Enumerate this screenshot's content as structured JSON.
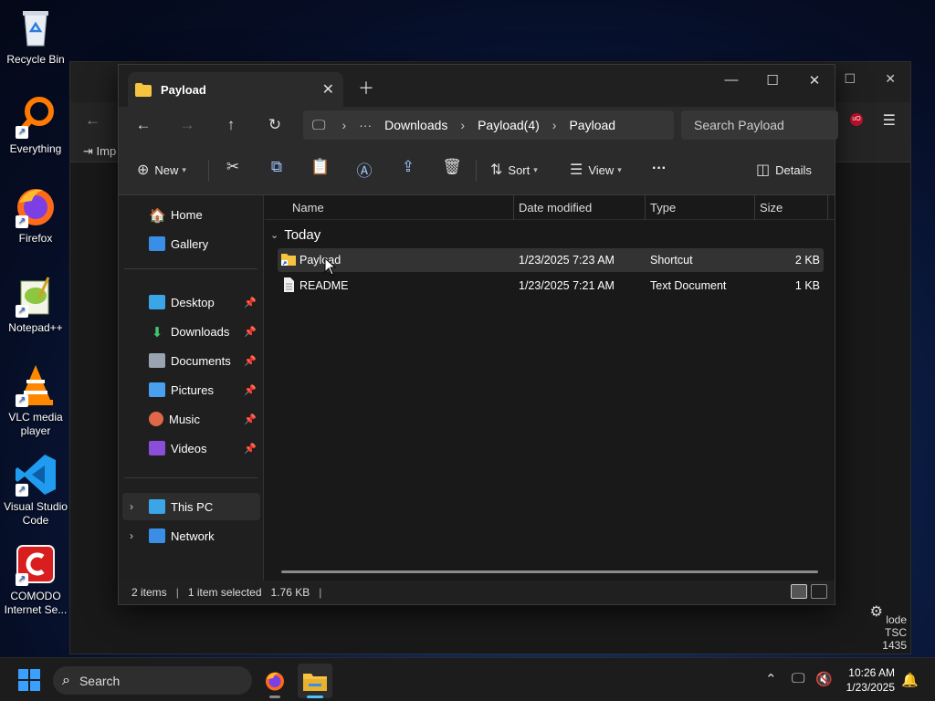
{
  "desktop": {
    "icons": [
      {
        "label": "Recycle Bin",
        "icon": "recycle-bin-icon"
      },
      {
        "label": "Everything",
        "icon": "everything-search-icon"
      },
      {
        "label": "Firefox",
        "icon": "firefox-icon"
      },
      {
        "label": "Notepad++",
        "icon": "notepad-plus-plus-icon"
      },
      {
        "label": "VLC media player",
        "icon": "vlc-icon"
      },
      {
        "label": "Visual Studio Code",
        "icon": "vscode-icon"
      },
      {
        "label": "COMODO Internet Se...",
        "icon": "comodo-icon"
      }
    ],
    "background_window": {
      "toolbar_label": "Imp",
      "side_text": [
        "lode",
        "TSC",
        "1435"
      ]
    }
  },
  "explorer": {
    "tab_title": "Payload",
    "caption": {
      "minimize": "—",
      "maximize": "☐",
      "close": "✕"
    },
    "breadcrumbs": [
      "Downloads",
      "Payload(4)",
      "Payload"
    ],
    "search_placeholder": "Search Payload",
    "commands": {
      "new": "New",
      "sort": "Sort",
      "view": "View",
      "more": "···",
      "details": "Details"
    },
    "nav": {
      "home": "Home",
      "gallery": "Gallery",
      "pinned": [
        "Desktop",
        "Downloads",
        "Documents",
        "Pictures",
        "Music",
        "Videos"
      ],
      "this_pc": "This PC",
      "network": "Network"
    },
    "columns": {
      "name": "Name",
      "date": "Date modified",
      "type": "Type",
      "size": "Size"
    },
    "group": "Today",
    "files": [
      {
        "name": "Payload",
        "date": "1/23/2025 7:23 AM",
        "type": "Shortcut",
        "size": "2 KB",
        "selected": true
      },
      {
        "name": "README",
        "date": "1/23/2025 7:21 AM",
        "type": "Text Document",
        "size": "1 KB",
        "selected": false
      }
    ],
    "status": {
      "items": "2 items",
      "selected": "1 item selected",
      "size": "1.76 KB"
    }
  },
  "taskbar": {
    "search_label": "Search",
    "time": "10:26 AM",
    "date": "1/23/2025"
  },
  "colors": {
    "accent": "#4cc2ff",
    "folder": "#f5c542",
    "window_bg": "#191919"
  }
}
